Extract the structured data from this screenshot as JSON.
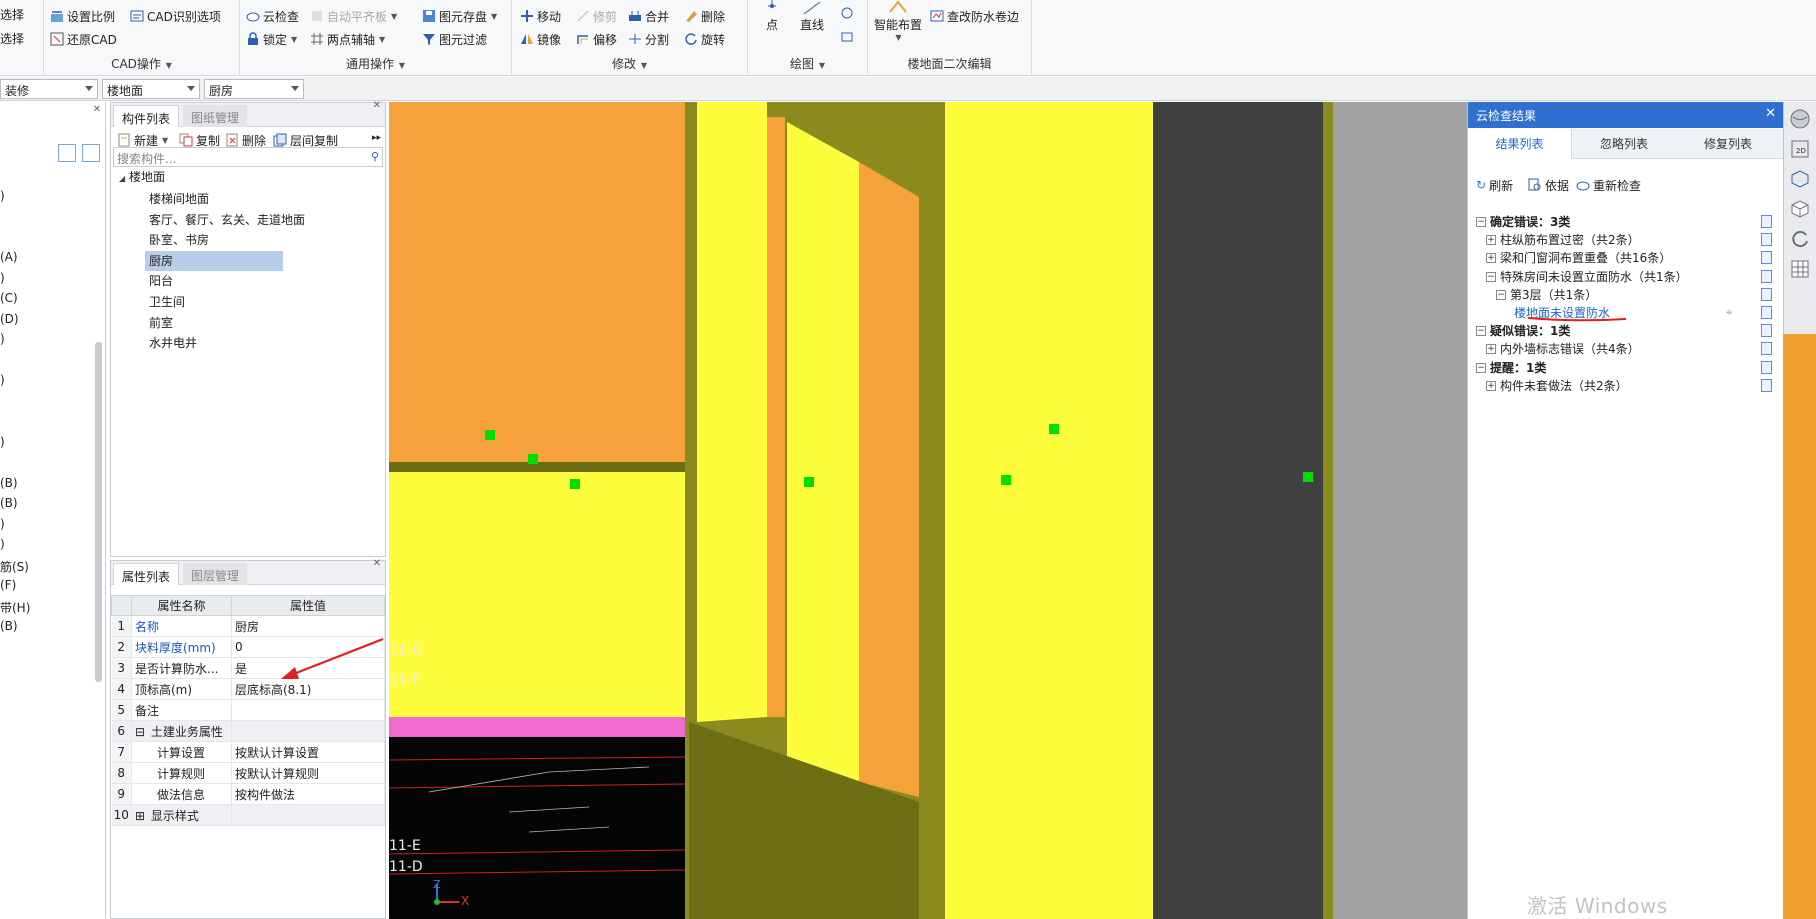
{
  "ribbon": {
    "groups": {
      "select": {
        "items": [
          "选择",
          "选择"
        ]
      },
      "cad": {
        "title": "CAD操作",
        "set_scale": "设置比例",
        "cad_options": "CAD识别选项",
        "restore_cad": "还原CAD"
      },
      "general": {
        "title": "通用操作",
        "cloud_check": "云检查",
        "auto_level": "自动平齐板",
        "lock": "锁定",
        "two_point_axis": "两点辅轴",
        "save_element": "图元存盘",
        "filter": "图元过滤"
      },
      "modify": {
        "title": "修改",
        "move": "移动",
        "trim": "修剪",
        "merge": "合并",
        "delete": "删除",
        "mirror": "镜像",
        "offset": "偏移",
        "split": "分割",
        "rotate": "旋转"
      },
      "draw": {
        "title": "绘图",
        "point": "点",
        "line": "直线"
      },
      "floor_edit": {
        "title": "楼地面二次编辑",
        "smart_layout": "智能布置",
        "check_waterproof": "查改防水卷边"
      }
    }
  },
  "combos": {
    "category": "装修",
    "type": "楼地面",
    "instance": "厨房"
  },
  "left_panel": {
    "items": [
      "",
      ")",
      "",
      "",
      "(A)",
      ")",
      "(C)",
      "(D)",
      ")",
      "",
      ")",
      "",
      "",
      ")",
      "",
      "(B)",
      "(B)",
      ")",
      ")",
      "筋(S)",
      "(F)",
      "带(H)",
      "(B)"
    ]
  },
  "component_panel": {
    "tabs": [
      "构件列表",
      "图纸管理"
    ],
    "toolbar": {
      "new": "新建",
      "copy": "复制",
      "delete": "删除",
      "floor_copy": "层间复制"
    },
    "search_placeholder": "搜索构件...",
    "root": "楼地面",
    "items": [
      "楼梯间地面",
      "客厅、餐厅、玄关、走道地面",
      "卧室、书房",
      "厨房",
      "阳台",
      "卫生间",
      "前室",
      "水井电井"
    ],
    "selected": "厨房"
  },
  "property_panel": {
    "tabs": [
      "属性列表",
      "图层管理"
    ],
    "headers": [
      "属性名称",
      "属性值"
    ],
    "rows": [
      {
        "num": "1",
        "name": "名称",
        "value": "厨房"
      },
      {
        "num": "2",
        "name": "块料厚度(mm)",
        "value": "0"
      },
      {
        "num": "3",
        "name": "是否计算防水...",
        "value": "是"
      },
      {
        "num": "4",
        "name": "顶标高(m)",
        "value": "层底标高(8.1)"
      },
      {
        "num": "5",
        "name": "备注",
        "value": ""
      },
      {
        "num": "6",
        "name": "土建业务属性",
        "value": ""
      },
      {
        "num": "7",
        "name": "计算设置",
        "value": "按默认计算设置"
      },
      {
        "num": "8",
        "name": "计算规则",
        "value": "按默认计算规则"
      },
      {
        "num": "9",
        "name": "做法信息",
        "value": "按构件做法"
      },
      {
        "num": "10",
        "name": "显示样式",
        "value": ""
      }
    ]
  },
  "viewport": {
    "axis_labels": [
      "11-G",
      "11-F",
      "11-E",
      "11-D"
    ],
    "axis_x": "X",
    "axis_z": "Z"
  },
  "cloud_panel": {
    "title": "云检查结果",
    "tabs": [
      "结果列表",
      "忽略列表",
      "修复列表"
    ],
    "actions": {
      "refresh": "刷新",
      "basis": "依据",
      "recheck": "重新检查"
    },
    "rows": [
      {
        "text": "确定错误：3类",
        "level": 0,
        "pm": "−",
        "bold": true
      },
      {
        "text": "柱纵筋布置过密（共2条）",
        "level": 1,
        "pm": "+"
      },
      {
        "text": "梁和门窗洞布置重叠（共16条）",
        "level": 1,
        "pm": "+"
      },
      {
        "text": "特殊房间未设置立面防水（共1条）",
        "level": 1,
        "pm": "−"
      },
      {
        "text": "第3层（共1条）",
        "level": 2,
        "pm": "−"
      },
      {
        "text": "楼地面未设置防水",
        "level": 3,
        "pm": "",
        "link": true
      },
      {
        "text": "疑似错误：1类",
        "level": 0,
        "pm": "−",
        "bold": true
      },
      {
        "text": "内外墙标志错误（共4条）",
        "level": 1,
        "pm": "+"
      },
      {
        "text": "提醒：1类",
        "level": 0,
        "pm": "−",
        "bold": true
      },
      {
        "text": "构件未套做法（共2条）",
        "level": 1,
        "pm": "+"
      }
    ]
  },
  "watermark": "激活 Windows",
  "colors": {
    "accent": "#2f6fd0",
    "orange": "#f5a23a",
    "yellow": "#fdfd3c",
    "olive": "#8c8c1e",
    "marker": "#00e000"
  }
}
